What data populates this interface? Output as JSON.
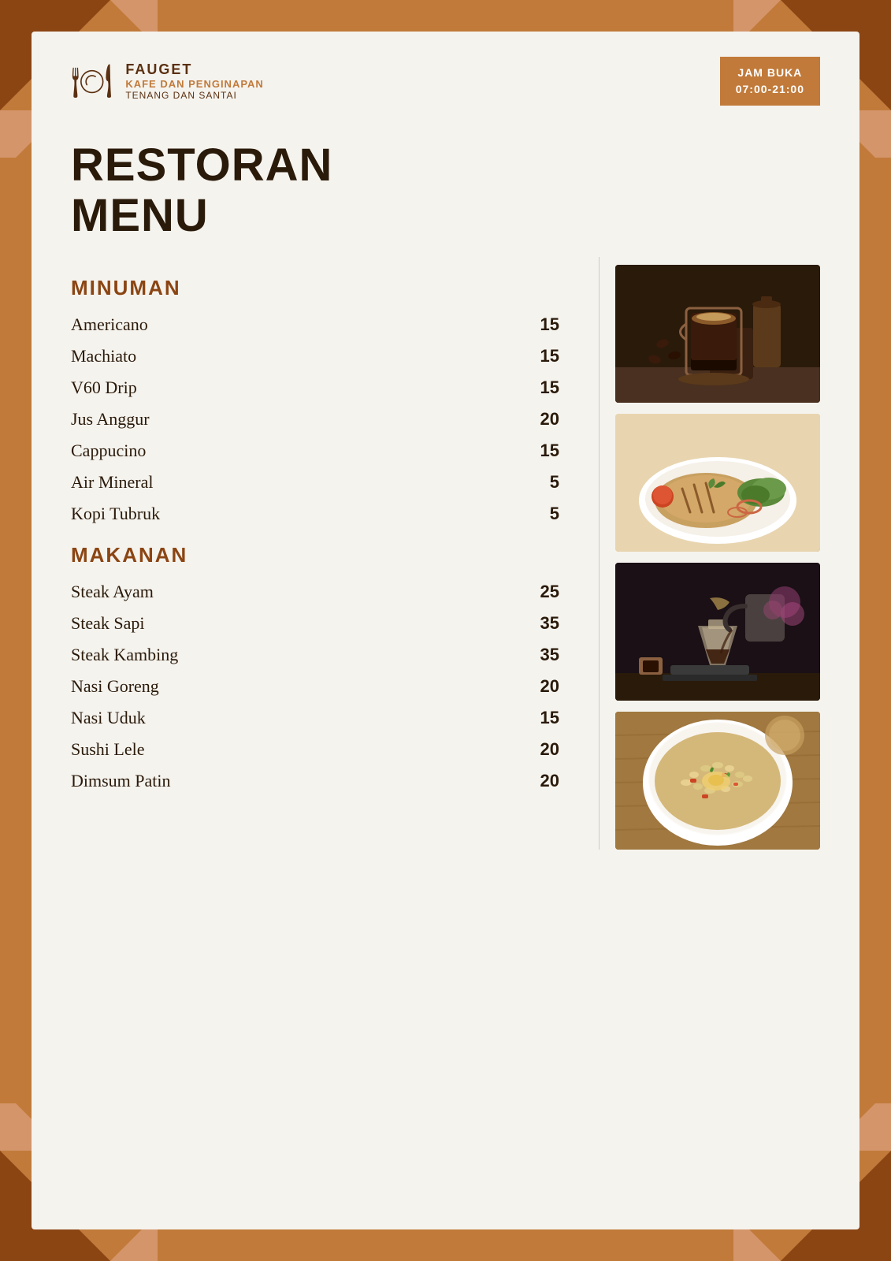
{
  "page": {
    "background_color": "#c17a3a"
  },
  "header": {
    "logo": {
      "name": "FAUGET",
      "subtitle1": "KAFE DAN PENGINAPAN",
      "subtitle2": "TENANG DAN SANTAI"
    },
    "hours_label": "JAM BUKA",
    "hours_value": "07:00-21:00"
  },
  "title": {
    "line1": "RESTORAN",
    "line2": "MENU"
  },
  "sections": [
    {
      "id": "minuman",
      "header": "MINUMAN",
      "items": [
        {
          "name": "Americano",
          "price": "15"
        },
        {
          "name": "Machiato",
          "price": "15"
        },
        {
          "name": "V60 Drip",
          "price": "15"
        },
        {
          "name": "Jus Anggur",
          "price": "20"
        },
        {
          "name": "Cappucino",
          "price": "15"
        },
        {
          "name": "Air Mineral",
          "price": "5"
        },
        {
          "name": "Kopi Tubruk",
          "price": "5"
        }
      ]
    },
    {
      "id": "makanan",
      "header": "MAKANAN",
      "items": [
        {
          "name": "Steak Ayam",
          "price": "25"
        },
        {
          "name": "Steak Sapi",
          "price": "35"
        },
        {
          "name": "Steak Kambing",
          "price": "35"
        },
        {
          "name": "Nasi Goreng",
          "price": "20"
        },
        {
          "name": "Nasi Uduk",
          "price": "15"
        },
        {
          "name": "Sushi Lele",
          "price": "20"
        },
        {
          "name": "Dimsum Patin",
          "price": "20"
        }
      ]
    }
  ],
  "images": [
    {
      "id": "coffee",
      "alt": "Coffee drink"
    },
    {
      "id": "chicken",
      "alt": "Chicken steak"
    },
    {
      "id": "pour",
      "alt": "Pour over coffee"
    },
    {
      "id": "rice",
      "alt": "Fried rice"
    }
  ]
}
